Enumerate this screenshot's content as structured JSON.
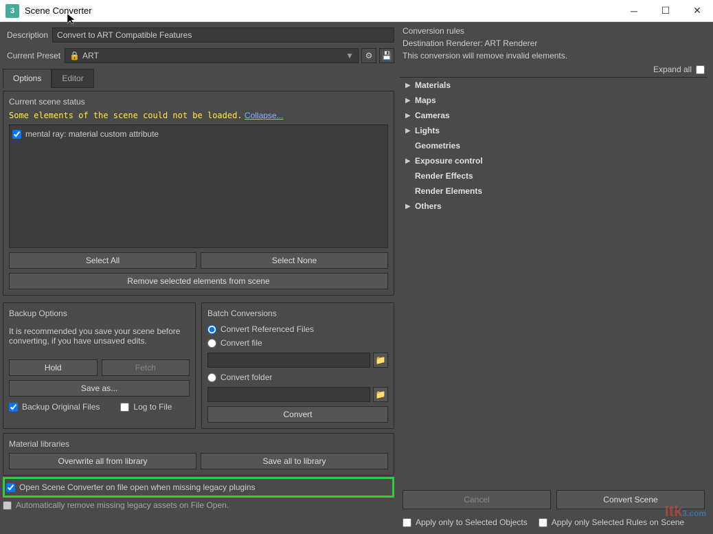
{
  "window": {
    "title": "Scene Converter"
  },
  "top": {
    "description_label": "Description",
    "description_value": "Convert to ART Compatible Features",
    "preset_label": "Current Preset",
    "preset_value": "ART"
  },
  "tabs": {
    "options": "Options",
    "editor": "Editor"
  },
  "status": {
    "heading": "Current scene status",
    "warning": "Some elements of the scene could not be loaded.",
    "collapse": "Collapse...",
    "item": "mental ray: material custom attribute",
    "select_all": "Select All",
    "select_none": "Select None",
    "remove": "Remove selected elements from scene"
  },
  "backup": {
    "heading": "Backup Options",
    "tip": "It is recommended you save your scene before converting, if you have unsaved edits.",
    "hold": "Hold",
    "fetch": "Fetch",
    "saveas": "Save as...",
    "backup_files": "Backup Original Files",
    "log": "Log to File"
  },
  "batch": {
    "heading": "Batch Conversions",
    "ref": "Convert Referenced Files",
    "file": "Convert file",
    "folder": "Convert folder",
    "convert": "Convert"
  },
  "mat": {
    "heading": "Material libraries",
    "overwrite": "Overwrite all from library",
    "saveall": "Save all to library"
  },
  "foot": {
    "open_conv": "Open Scene Converter on file open when missing legacy plugins",
    "auto_remove": "Automatically remove missing legacy assets on File Open."
  },
  "rules": {
    "heading": "Conversion rules",
    "dest": "Destination Renderer: ART Renderer",
    "desc": "This conversion will remove invalid elements.",
    "expand": "Expand all",
    "items": [
      {
        "arrow": true,
        "label": "Materials"
      },
      {
        "arrow": true,
        "label": "Maps"
      },
      {
        "arrow": true,
        "label": "Cameras"
      },
      {
        "arrow": true,
        "label": "Lights"
      },
      {
        "arrow": false,
        "label": "Geometries"
      },
      {
        "arrow": true,
        "label": "Exposure control"
      },
      {
        "arrow": false,
        "label": "Render Effects"
      },
      {
        "arrow": false,
        "label": "Render Elements"
      },
      {
        "arrow": true,
        "label": "Others"
      }
    ],
    "cancel": "Cancel",
    "convert_scene": "Convert Scene",
    "apply_sel": "Apply only to Selected Objects",
    "apply_rules": "Apply only Selected Rules on Scene"
  }
}
